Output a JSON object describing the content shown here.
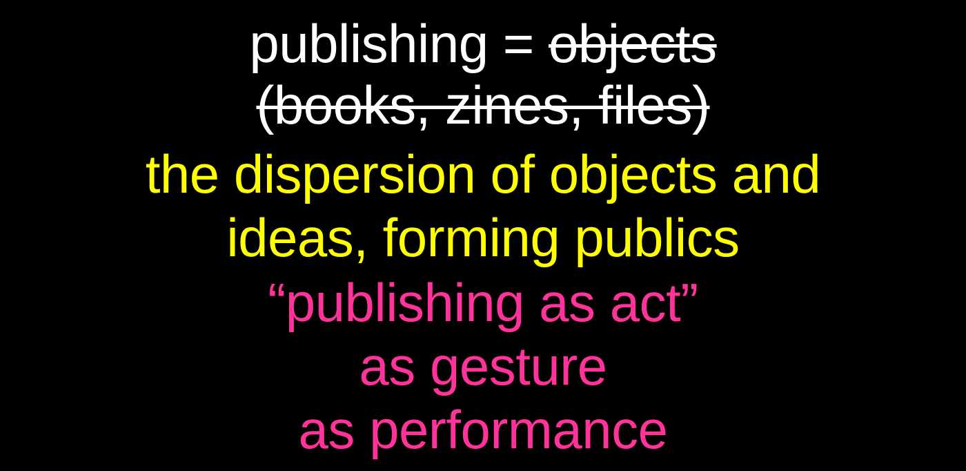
{
  "slide": {
    "line1": {
      "prefix": "publishing = ",
      "struck": "objects"
    },
    "line2": {
      "struck": "(books, zines, files)"
    },
    "line3": "the dispersion of objects and",
    "line4": "ideas, forming publics",
    "line5": "“publishing as act”",
    "line6": "as gesture",
    "line7": "as performance",
    "colors": {
      "background": "#000000",
      "white": "#ffffff",
      "yellow": "#ffff00",
      "pink": "#ff3399"
    }
  }
}
